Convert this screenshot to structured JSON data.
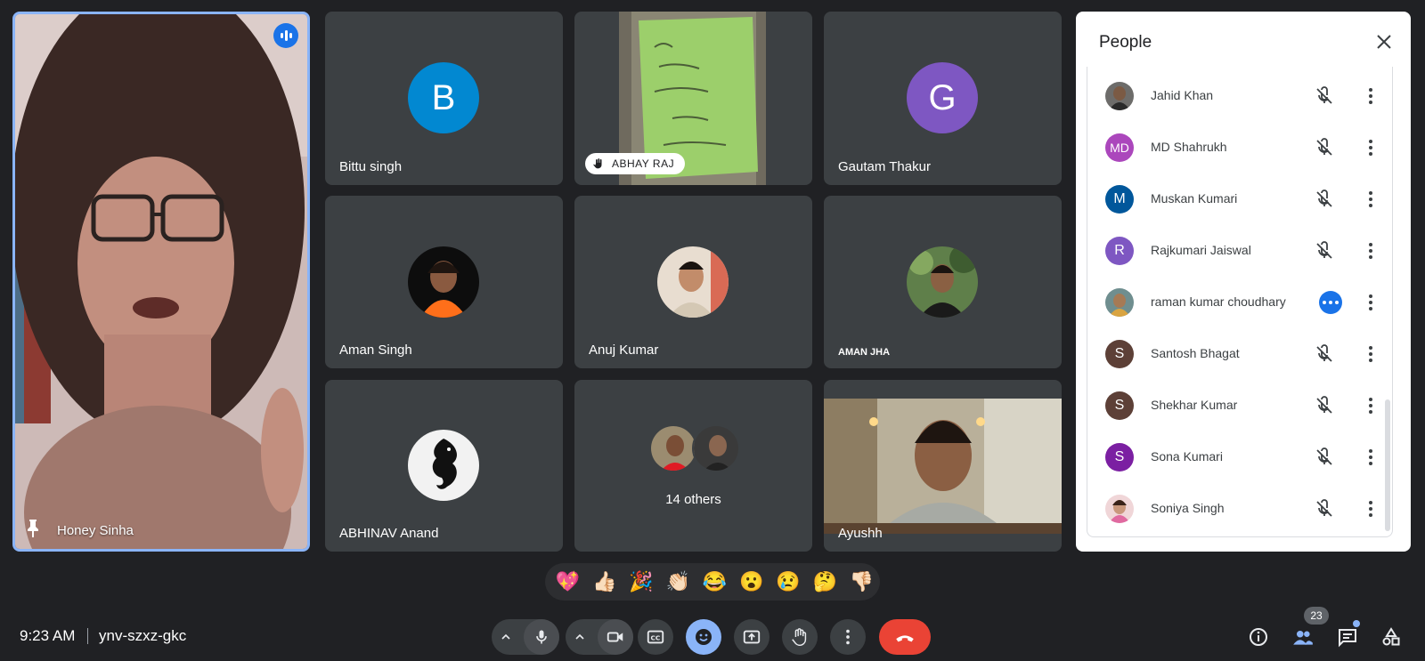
{
  "main_speaker": {
    "name": "Honey Sinha",
    "pinned": true,
    "speaking": true
  },
  "tiles": [
    {
      "name": "Bittu singh",
      "avatar_letter": "B",
      "avatar_color": "#0288d1"
    },
    {
      "name": "ABHAY RAJ",
      "type": "video-with-hand"
    },
    {
      "name": "Gautam Thakur",
      "avatar_letter": "G",
      "avatar_color": "#7e57c2"
    },
    {
      "name": "Aman Singh",
      "type": "photo"
    },
    {
      "name": "Anuj Kumar",
      "type": "photo"
    },
    {
      "name": "AMAN JHA",
      "type": "photo"
    },
    {
      "name": "ABHINAV Anand",
      "type": "photo"
    },
    {
      "name": "14 others",
      "type": "others"
    },
    {
      "name": "Ayushh",
      "type": "video"
    }
  ],
  "people_panel": {
    "title": "People",
    "participants": [
      {
        "name": "Jahid Khan",
        "avatar": "photo",
        "status": "muted"
      },
      {
        "name": "MD Shahrukh",
        "avatar_letter": "MD",
        "avatar_color": "#ab47bc",
        "status": "muted"
      },
      {
        "name": "Muskan Kumari",
        "avatar_letter": "M",
        "avatar_color": "#01579b",
        "status": "muted"
      },
      {
        "name": "Rajkumari Jaiswal",
        "avatar_letter": "R",
        "avatar_color": "#7e57c2",
        "status": "muted"
      },
      {
        "name": "raman kumar choudhary",
        "avatar": "photo",
        "status": "speaking"
      },
      {
        "name": "Santosh Bhagat",
        "avatar_letter": "S",
        "avatar_color": "#5d4037",
        "status": "muted"
      },
      {
        "name": "Shekhar Kumar",
        "avatar_letter": "S",
        "avatar_color": "#5d4037",
        "status": "muted"
      },
      {
        "name": "Sona Kumari",
        "avatar_letter": "S",
        "avatar_color": "#7b1fa2",
        "status": "muted"
      },
      {
        "name": "Soniya Singh",
        "avatar": "photo",
        "status": "muted"
      }
    ]
  },
  "reactions": [
    "💖",
    "👍🏻",
    "🎉",
    "👏🏻",
    "😂",
    "😮",
    "😢",
    "🤔",
    "👎🏻"
  ],
  "bottom_bar": {
    "time": "9:23 AM",
    "meeting_code": "ynv-szxz-gkc",
    "participant_count": "23",
    "accent_color": "#8ab4f8",
    "leave_color": "#ea4335"
  }
}
